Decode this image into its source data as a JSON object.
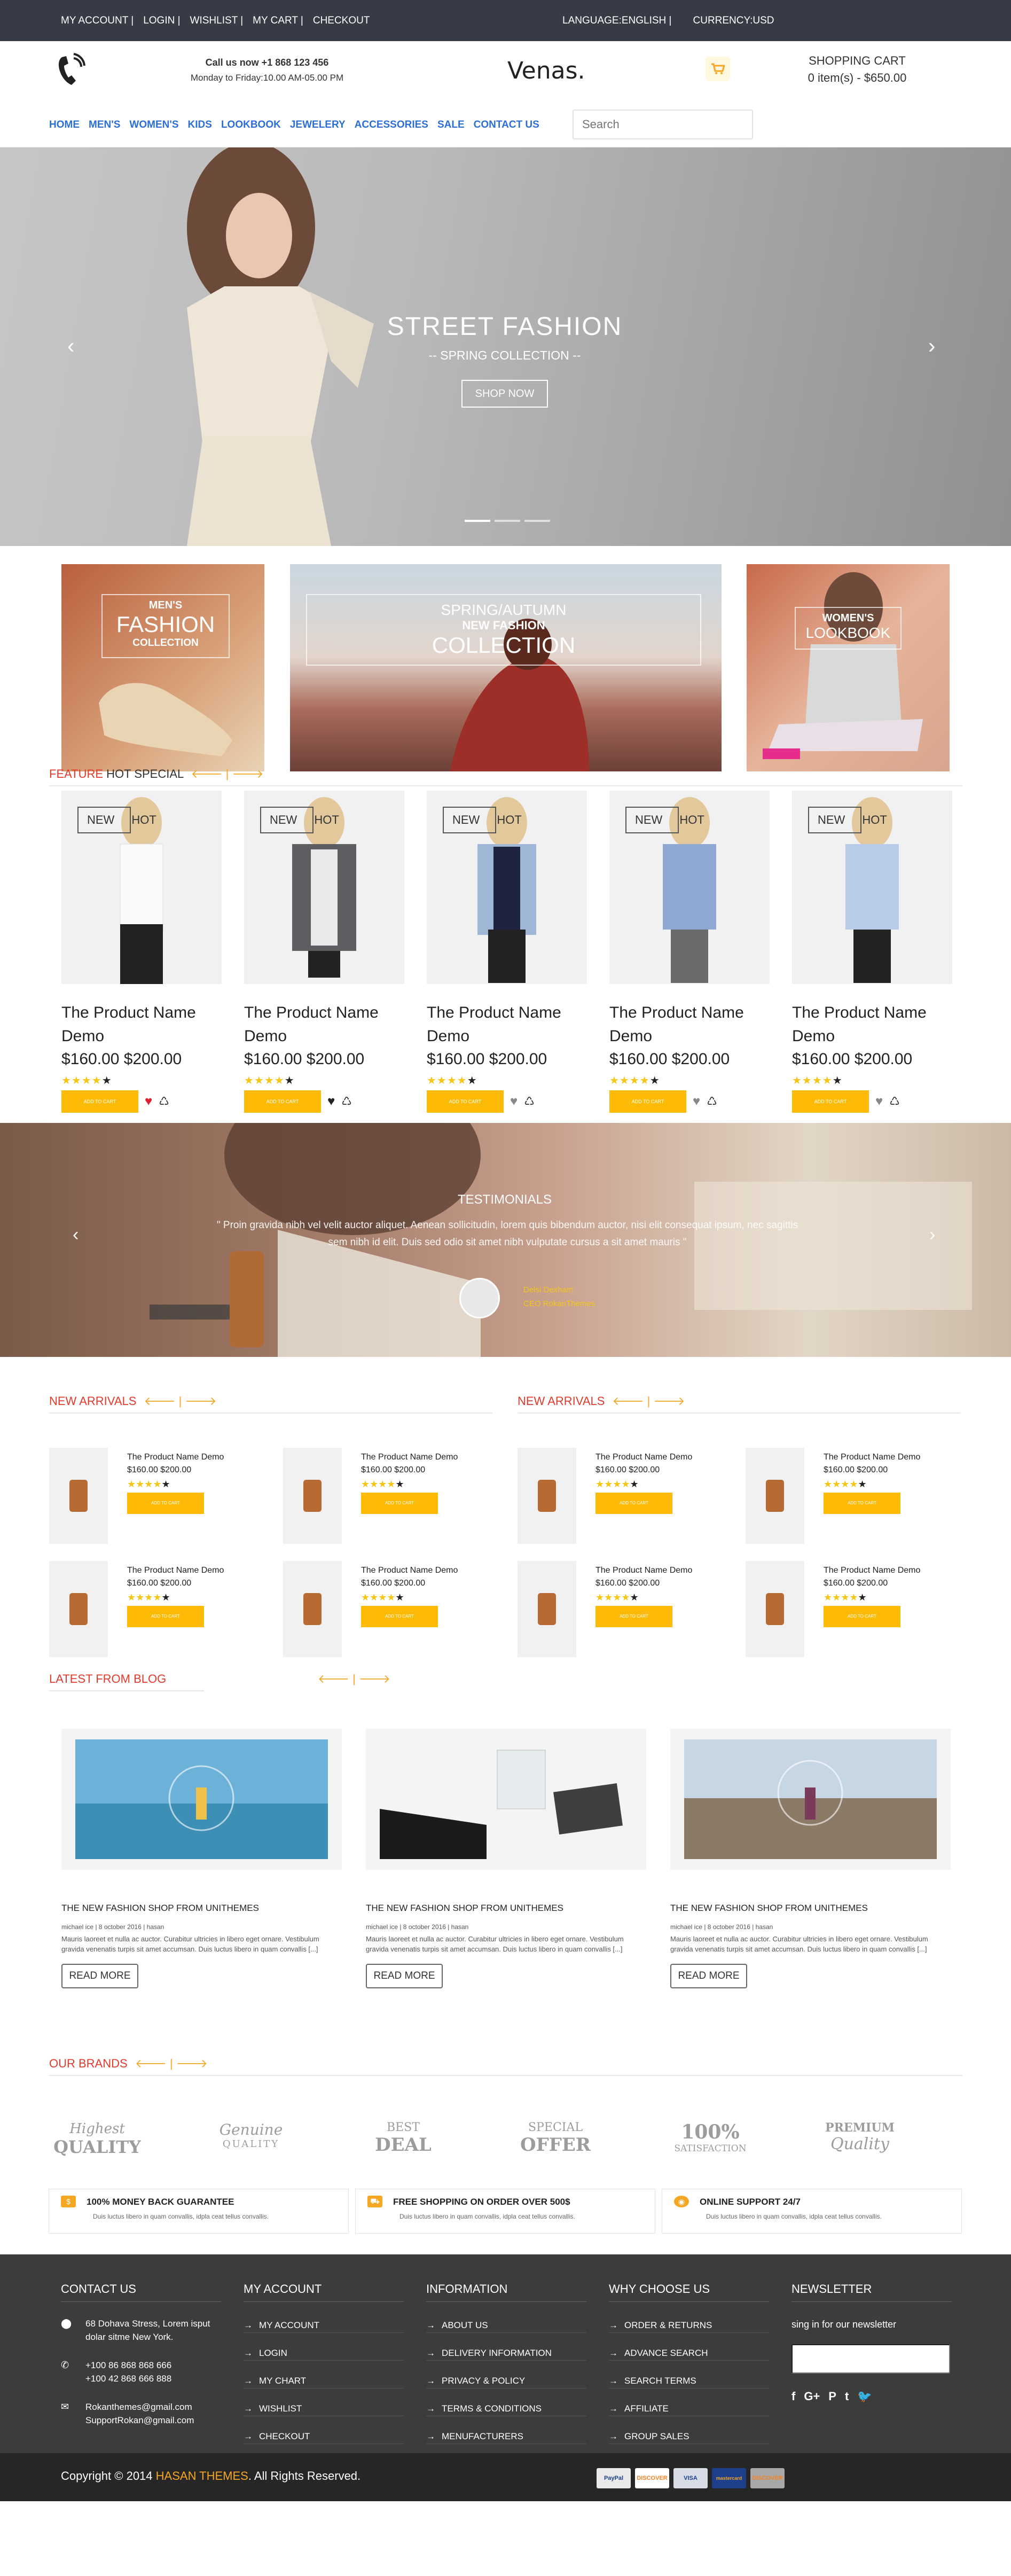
{
  "topbar": {
    "links": [
      "MY ACCOUNT |",
      "LOGIN |",
      "WISHLIST |",
      "MY CART |",
      "CHECKOUT"
    ],
    "language": "LANGUAGE:ENGLISH |",
    "currency": "CURRENCY:USD"
  },
  "header": {
    "call_line": "Call us now +1 868 123 456",
    "hours": "Monday to Friday:10.00 AM-05.00 PM",
    "logo": "Venas.",
    "cart_title": "SHOPPING CART",
    "cart_summary": "0 item(s) - $650.00"
  },
  "nav": {
    "items": [
      "HOME",
      "MEN'S",
      "WOMEN'S",
      "KIDS",
      "LOOKBOOK",
      "JEWELERY",
      "ACCESSORIES",
      "SALE",
      "CONTACT US"
    ],
    "search_placeholder": "Search"
  },
  "hero": {
    "title": "STREET FASHION",
    "subtitle": "-- SPRING COLLECTION --",
    "button": "SHOP NOW",
    "prev_icon": "chevron-left-icon",
    "next_icon": "chevron-right-icon"
  },
  "banners": {
    "mens": {
      "line1": "MEN'S",
      "line2": "FASHION",
      "line3": "COLLECTION"
    },
    "spring": {
      "line1": "SPRING/AUTUMN",
      "line2": "NEW FASHION",
      "line3": "COLLECTION"
    },
    "womens": {
      "line1": "WOMEN'S",
      "line2": "LOOKBOOK"
    }
  },
  "feature": {
    "title_red": "FEATURE",
    "title_rest": "HOT SPECIAL",
    "products": [
      {
        "badge1": "NEW",
        "badge2": "HOT",
        "name": "The Product Name Demo",
        "price": "$160.00 $200.00",
        "add": "ADD TO CART"
      },
      {
        "badge1": "NEW",
        "badge2": "HOT",
        "name": "The Product Name Demo",
        "price": "$160.00 $200.00",
        "add": "ADD TO CART"
      },
      {
        "badge1": "NEW",
        "badge2": "HOT",
        "name": "The Product Name Demo",
        "price": "$160.00 $200.00",
        "add": "ADD TO CART"
      },
      {
        "badge1": "NEW",
        "badge2": "HOT",
        "name": "The Product Name Demo",
        "price": "$160.00 $200.00",
        "add": "ADD TO CART"
      },
      {
        "badge1": "NEW",
        "badge2": "HOT",
        "name": "The Product Name Demo",
        "price": "$160.00 $200.00",
        "add": "ADD TO CART"
      }
    ]
  },
  "testimonial": {
    "title": "TESTIMONIALS",
    "quote_line1": "\" Proin gravida nibh vel velit auctor aliquet. Aenean sollicitudin, lorem quis bibendum auctor, nisi elit consequat ipsum, nec sagittis",
    "quote_line2": "sem nibh id elit. Duis sed odio sit amet nibh vulputate cursus a sit amet mauris \"",
    "name": "Delsi Dexham",
    "role": "CEO RokanThemes"
  },
  "arrivals": {
    "title_left": "NEW ARRIVALS",
    "title_right": "NEW ARRIVALS",
    "items": [
      {
        "name": "The Product Name Demo",
        "price": "$160.00 $200.00",
        "add": "ADD TO CART"
      },
      {
        "name": "The Product Name Demo",
        "price": "$160.00 $200.00",
        "add": "ADD TO CART"
      },
      {
        "name": "The Product Name Demo",
        "price": "$160.00 $200.00",
        "add": "ADD TO CART"
      },
      {
        "name": "The Product Name Demo",
        "price": "$160.00 $200.00",
        "add": "ADD TO CART"
      },
      {
        "name": "The Product Name Demo",
        "price": "$160.00 $200.00",
        "add": "ADD TO CART"
      },
      {
        "name": "The Product Name Demo",
        "price": "$160.00 $200.00",
        "add": "ADD TO CART"
      },
      {
        "name": "The Product Name Demo",
        "price": "$160.00 $200.00",
        "add": "ADD TO CART"
      },
      {
        "name": "The Product Name Demo",
        "price": "$160.00 $200.00",
        "add": "ADD TO CART"
      }
    ]
  },
  "blog": {
    "title": "LATEST FROM BLOG",
    "posts": [
      {
        "title": "THE NEW FASHION SHOP FROM UNITHEMES",
        "meta": "michael ice  |  8 october 2016  |  hasan",
        "text": "Mauris laoreet et nulla ac auctor. Curabitur ultricies in libero eget ornare. Vestibulum gravida venenatis turpis sit amet accumsan. Duis luctus libero in quam convallis [...]",
        "more": "READ MORE"
      },
      {
        "title": "THE NEW FASHION SHOP FROM UNITHEMES",
        "meta": "michael ice  |  8 october 2016  |  hasan",
        "text": "Mauris laoreet et nulla ac auctor. Curabitur ultricies in libero eget ornare. Vestibulum gravida venenatis turpis sit amet accumsan. Duis luctus libero in quam convallis [...]",
        "more": "READ MORE"
      },
      {
        "title": "THE NEW FASHION SHOP FROM UNITHEMES",
        "meta": "michael ice  |  8 october 2016  |  hasan",
        "text": "Mauris laoreet et nulla ac auctor. Curabitur ultricies in libero eget ornare. Vestibulum gravida venenatis turpis sit amet accumsan. Duis luctus libero in quam convallis [...]",
        "more": "READ MORE"
      }
    ]
  },
  "brands": {
    "title": "OUR BRANDS",
    "logos": [
      {
        "l1": "Highest",
        "l2": "QUALITY"
      },
      {
        "l1": "Genuine",
        "l2": "QUALITY"
      },
      {
        "l1": "BEST",
        "l2": "DEAL"
      },
      {
        "l1": "SPECIAL",
        "l2": "OFFER"
      },
      {
        "l1": "100%",
        "l2": "SATISFACTION"
      },
      {
        "l1": "PREMIUM",
        "l2": "Quality"
      }
    ],
    "features": [
      {
        "title": "100% MONEY BACK GUARANTEE",
        "desc": "Duis luctus libero in quam convallis, idpla ceat tellus convallis."
      },
      {
        "title": "FREE SHOPPING ON ORDER OVER 500$",
        "desc": "Duis luctus libero in quam convallis, idpla ceat tellus convallis."
      },
      {
        "title": "ONLINE SUPPORT 24/7",
        "desc": "Duis luctus libero in quam convallis, idpla ceat tellus convallis."
      }
    ]
  },
  "footer": {
    "contact": {
      "title": "CONTACT US",
      "address": "68 Dohava Stress, Lorem isput dolar sitme New York.",
      "phone1": "+100 86 868 868 666",
      "phone2": "+100 42 868 666 888",
      "email1": "Rokanthemes@gmail.com",
      "email2": "SupportRokan@gmail.com"
    },
    "account": {
      "title": "MY ACCOUNT",
      "links": [
        "MY ACCOUNT",
        "LOGIN",
        "MY CHART",
        "WISHLIST",
        "CHECKOUT"
      ]
    },
    "information": {
      "title": "INFORMATION",
      "links": [
        "ABOUT US",
        "DELIVERY INFORMATION",
        "PRIVACY & POLICY",
        "TERMS & CONDITIONS",
        "MENUFACTURERS"
      ]
    },
    "why": {
      "title": "WHY CHOOSE US",
      "links": [
        "ORDER & RETURNS",
        "ADVANCE SEARCH",
        "SEARCH TERMS",
        "AFFILIATE",
        "GROUP SALES"
      ]
    },
    "newsletter": {
      "title": "NEWSLETTER",
      "text": "sing in for our newsletter",
      "social": [
        "f",
        "G+",
        "P",
        "t",
        "bird-icon"
      ]
    },
    "copyright_pre": "Copyright © 2014",
    "copyright_brand": "HASAN THEMES",
    "copyright_post": ". All Rights Reserved.",
    "payments": [
      "PayPal",
      "DISCOVER",
      "VISA",
      "mastercard",
      "DISCOVER"
    ]
  }
}
